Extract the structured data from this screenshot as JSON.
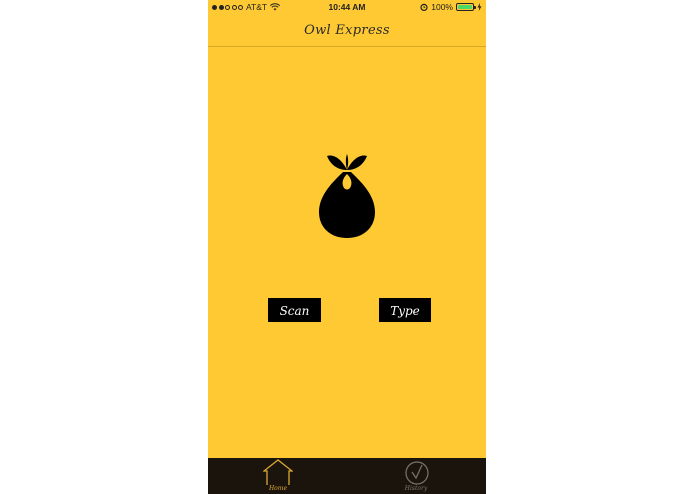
{
  "status_bar": {
    "carrier": "AT&T",
    "time": "10:44 AM",
    "battery_percent": "100%",
    "signal_bars_filled": 2,
    "signal_bars_total": 5,
    "battery_level": 1.0
  },
  "nav": {
    "title": "Owl Express"
  },
  "actions": {
    "scan_label": "Scan",
    "type_label": "Type"
  },
  "tabs": {
    "home_label": "Home",
    "history_label": "History",
    "active": "Home"
  },
  "colors": {
    "background": "#FEC933",
    "button_bg": "#000000",
    "tabbar_bg": "#1B140C",
    "active_tab": "#D9A734",
    "inactive_tab": "#7A7468",
    "battery": "#4CD964"
  },
  "icons": {
    "logo": "sack-icon",
    "home": "home-icon",
    "history": "history-icon"
  }
}
